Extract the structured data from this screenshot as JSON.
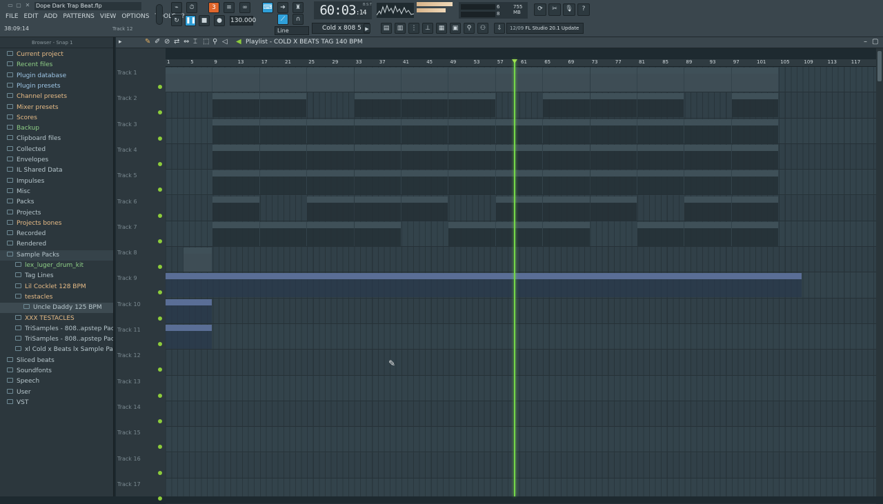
{
  "window": {
    "project_title": "Dope Dark Trap Beat.flp"
  },
  "menu": [
    "FILE",
    "EDIT",
    "ADD",
    "PATTERNS",
    "VIEW",
    "OPTIONS",
    "TOOLS",
    "?"
  ],
  "hint_bar": {
    "time": "38:09:14",
    "track": "Track 12"
  },
  "transport": {
    "tempo": "130.000",
    "song_pos_main": "60:03",
    "song_pos_ticks": "14",
    "clock_unit": "B:S:T",
    "pattern": "Cold x 808 5",
    "snap_mode": "Line"
  },
  "monitor": {
    "mem_value": "755 MB",
    "cpu_value": "6",
    "poly_value": "8"
  },
  "news": {
    "date": "12/09",
    "text": "FL Studio 20.1 Update"
  },
  "browser": {
    "header": "Browser - Snap 1",
    "items": [
      {
        "label": "Current project",
        "style": "c1"
      },
      {
        "label": "Recent files",
        "style": "c2"
      },
      {
        "label": "Plugin database",
        "style": "c3"
      },
      {
        "label": "Plugin presets",
        "style": "c3"
      },
      {
        "label": "Channel presets",
        "style": "c1"
      },
      {
        "label": "Mixer presets",
        "style": "c1"
      },
      {
        "label": "Scores",
        "style": "c1"
      },
      {
        "label": "Backup",
        "style": "c2"
      },
      {
        "label": "Clipboard files",
        "style": ""
      },
      {
        "label": "Collected",
        "style": ""
      },
      {
        "label": "Envelopes",
        "style": ""
      },
      {
        "label": "IL Shared Data",
        "style": ""
      },
      {
        "label": "Impulses",
        "style": ""
      },
      {
        "label": "Misc",
        "style": ""
      },
      {
        "label": "Packs",
        "style": ""
      },
      {
        "label": "Projects",
        "style": ""
      },
      {
        "label": "Projects bones",
        "style": "c1"
      },
      {
        "label": "Recorded",
        "style": ""
      },
      {
        "label": "Rendered",
        "style": ""
      },
      {
        "label": "Sample Packs",
        "style": "sel"
      },
      {
        "label": "lex_luger_drum_kit",
        "style": "c2 sub"
      },
      {
        "label": "Tag Lines",
        "style": "sub"
      },
      {
        "label": "Lil Cocklet 128 BPM",
        "style": "c1 sub"
      },
      {
        "label": "testacles",
        "style": "c1 sub"
      },
      {
        "label": "Uncle Daddy 125 BPM",
        "style": "sel2 sub2"
      },
      {
        "label": "XXX TESTACLES",
        "style": "c1 sub"
      },
      {
        "label": "TriSamples - 808..apstep Pack Vol 1",
        "style": "sub"
      },
      {
        "label": "TriSamples - 808..apstep Pack Vol 2",
        "style": "sub"
      },
      {
        "label": "xl Cold x Beats lx Sample Pack",
        "style": "sub"
      },
      {
        "label": "Sliced beats",
        "style": ""
      },
      {
        "label": "Soundfonts",
        "style": ""
      },
      {
        "label": "Speech",
        "style": ""
      },
      {
        "label": "User",
        "style": ""
      },
      {
        "label": "VST",
        "style": ""
      }
    ]
  },
  "playlist": {
    "title": "Playlist - COLD X BEATS TAG 140 BPM",
    "ruler": [
      "1",
      "5",
      "9",
      "13",
      "17",
      "21",
      "25",
      "29",
      "33",
      "37",
      "41",
      "45",
      "49",
      "53",
      "57",
      "61",
      "65",
      "69",
      "73",
      "77",
      "81",
      "85",
      "89",
      "93",
      "97",
      "101",
      "105",
      "109",
      "113",
      "117"
    ],
    "tracks": [
      "Track 1",
      "Track 2",
      "Track 3",
      "Track 4",
      "Track 5",
      "Track 6",
      "Track 7",
      "Track 8",
      "Track 9",
      "Track 10",
      "Track 11",
      "Track 12",
      "Track 13",
      "Track 14",
      "Track 15",
      "Track 16",
      "Track 17"
    ],
    "clip_names": {
      "t1": "Omnisphere",
      "t2": "Cold x 808 5",
      "t3": "HiHat Clo..003 MC38",
      "t4": "Snare Dru..808 Fizz",
      "t5": "Snare Dru..022 Duo",
      "t6a": "Kick Drum 001 Tight",
      "t6b": "Kick Dru..001 Tight",
      "t7": "xOpen Hat 5",
      "t8": "COLD..BPM",
      "t9": "Gross Beat - Mix level",
      "t10": "Gross Beat..ix level",
      "t11": "Param. E..Mix level"
    }
  }
}
